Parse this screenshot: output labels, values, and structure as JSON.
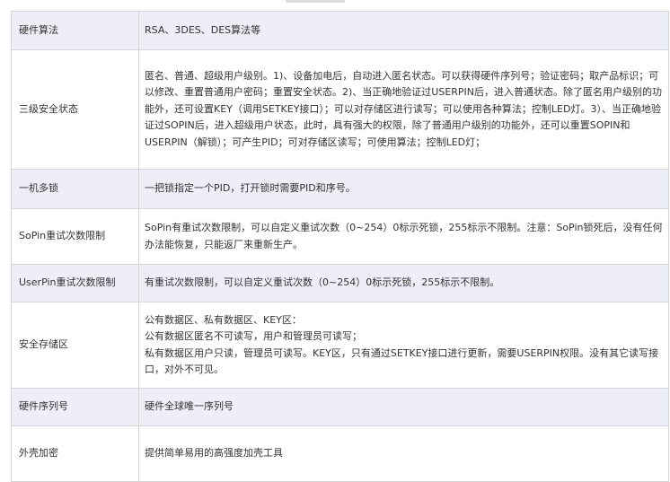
{
  "rows": [
    {
      "key": "硬件算法",
      "lines": [
        "RSA、3DES、DES算法等"
      ]
    },
    {
      "key": "三级安全状态",
      "lines": [
        "匿名、普通、超级用户级别。1)、设备加电后，自动进入匿名状态。可以获得硬件序列号；验证密码；取产品标识；可以修改、重置普通用户密码；重置安全状态。2)、当正确地验证过USERPIN后，进入普通状态。除了匿名用户级别的功能外，还可设置KEY（调用SETKEY接口）；可以对存储区进行读写；可以使用各种算法；控制LED灯。3）、当正确地验证过SOPIN后，进入超级用户状态，此时，具有强大的权限，除了普通用户级别的功能外，还可以重置SOPIN和USERPIN（解锁）；可产生PID；可对存储区读写；可使用算法；控制LED灯；"
      ]
    },
    {
      "key": "一机多锁",
      "lines": [
        "一把锁指定一个PID，打开锁时需要PID和序号。"
      ]
    },
    {
      "key": "SoPin重试次数限制",
      "lines": [
        "SoPin有重试次数限制，可以自定义重试次数（0~254）0标示死锁，255标示不限制。注意：SoPin锁死后，没有任何办法能恢复，只能返厂来重新生产。"
      ]
    },
    {
      "key": "UserPin重试次数限制",
      "lines": [
        "有重试次数限制，可以自定义重试次数（0~254）0标示死锁，255标示不限制。"
      ]
    },
    {
      "key": "安全存储区",
      "lines": [
        "公有数据区、私有数据区、KEY区：",
        "公有数据区匿名不可读写，用户和管理员可读写；",
        "私有数据区用户只读，管理员可读写。KEY区，只有通过SETKEY接口进行更新，需要USERPIN权限。没有其它读写接口，对外不可见。"
      ]
    },
    {
      "key": "硬件序列号",
      "lines": [
        "硬件全球唯一序列号"
      ]
    },
    {
      "key": "外壳加密",
      "lines": [
        "提供简单易用的高强度加壳工具"
      ]
    }
  ]
}
